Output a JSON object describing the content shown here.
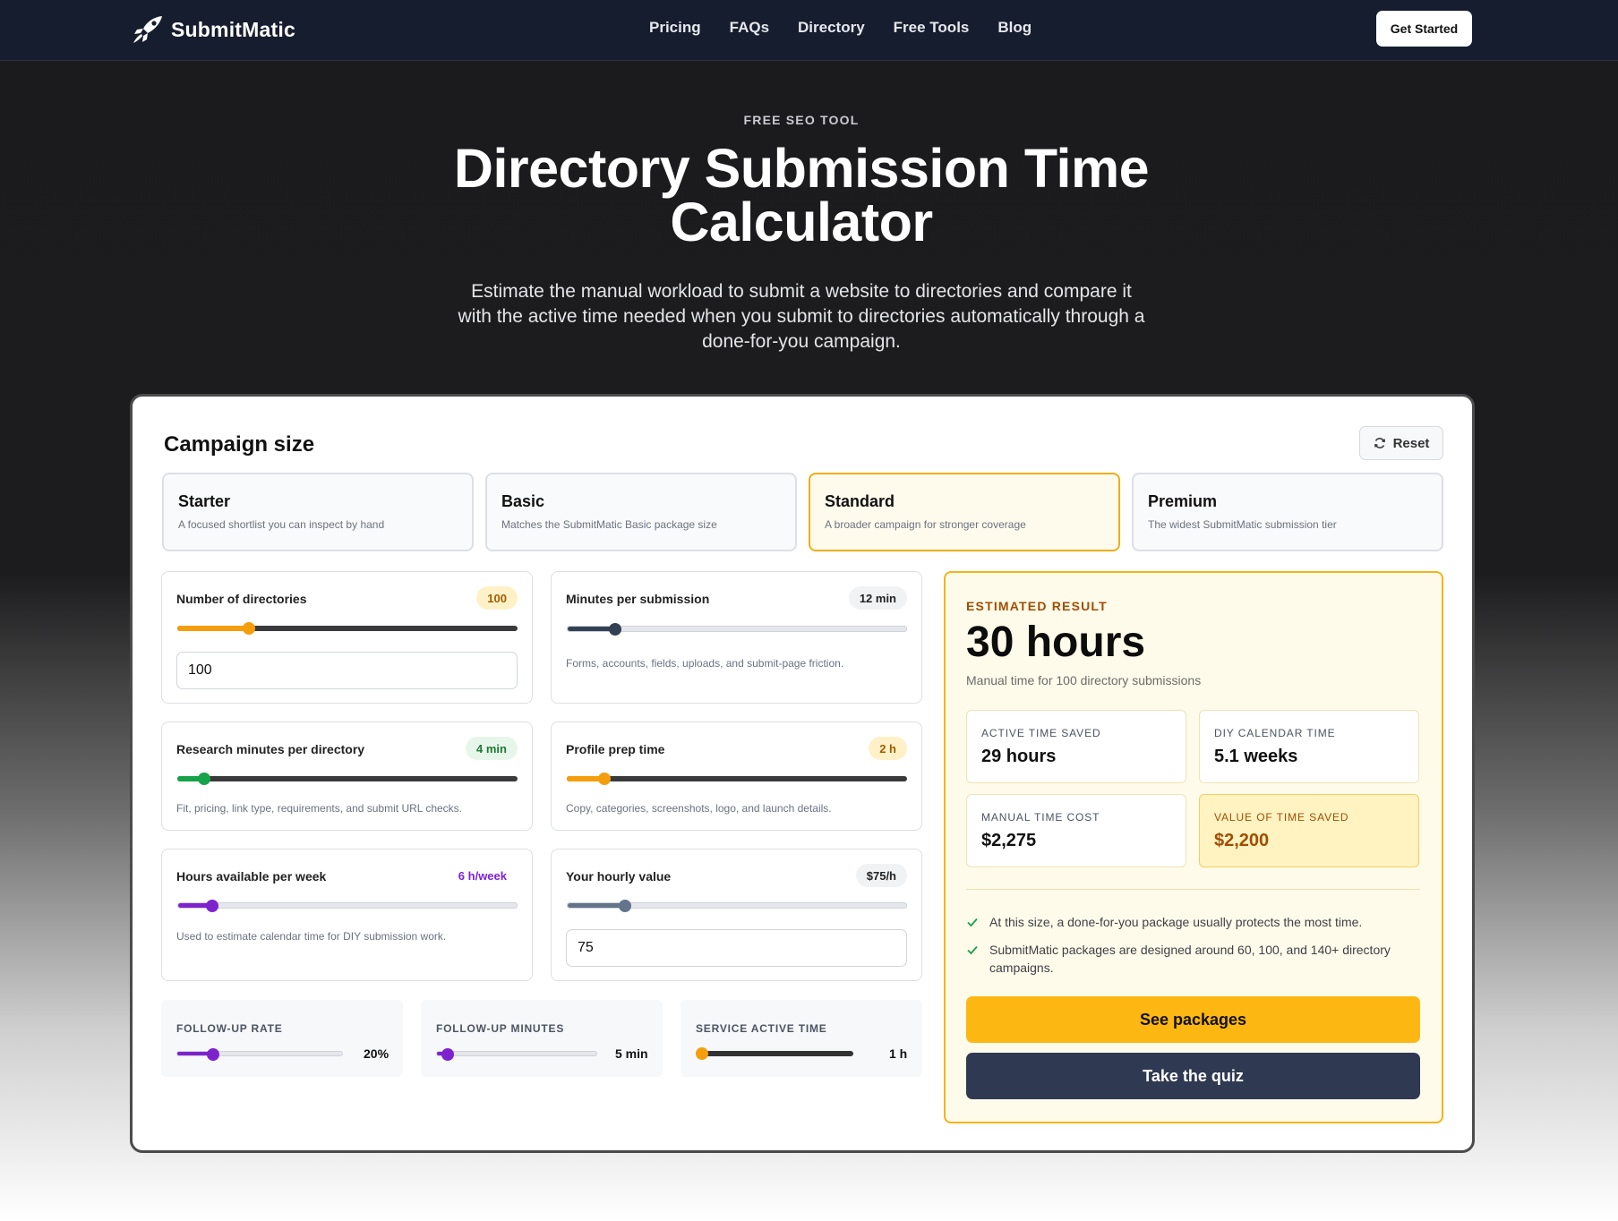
{
  "nav": {
    "brand": "SubmitMatic",
    "links": [
      "Pricing",
      "FAQs",
      "Directory",
      "Free Tools",
      "Blog"
    ],
    "cta": "Get Started"
  },
  "hero": {
    "eyebrow": "FREE SEO TOOL",
    "title": "Directory Submission Time Calculator",
    "subtitle": "Estimate the manual workload to submit a website to directories and compare it with the active time needed when you submit to directories automatically through a done-for-you campaign."
  },
  "campaign": {
    "title": "Campaign size",
    "reset": "Reset",
    "tiers": [
      {
        "name": "Starter",
        "desc": "A focused shortlist you can inspect by hand"
      },
      {
        "name": "Basic",
        "desc": "Matches the SubmitMatic Basic package size"
      },
      {
        "name": "Standard",
        "desc": "A broader campaign for stronger coverage",
        "selected": true
      },
      {
        "name": "Premium",
        "desc": "The widest SubmitMatic submission tier"
      }
    ]
  },
  "inputs": {
    "directories": {
      "label": "Number of directories",
      "value": "100",
      "input_value": "100",
      "fill_pct": 21,
      "color": "#f59e0b"
    },
    "minutes": {
      "label": "Minutes per submission",
      "value": "12 min",
      "hint": "Forms, accounts, fields, uploads, and submit-page friction.",
      "fill_pct": 14,
      "color": "#334155"
    },
    "research": {
      "label": "Research minutes per directory",
      "value": "4 min",
      "hint": "Fit, pricing, link type, requirements, and submit URL checks.",
      "fill_pct": 8,
      "color": "#16a34a"
    },
    "profile": {
      "label": "Profile prep time",
      "value": "2 h",
      "hint": "Copy, categories, screenshots, logo, and launch details.",
      "fill_pct": 11,
      "color": "#f59e0b"
    },
    "hours": {
      "label": "Hours available per week",
      "value": "6 h/week",
      "hint": "Used to estimate calendar time for DIY submission work.",
      "fill_pct": 10,
      "color": "#7e22ce"
    },
    "hourly": {
      "label": "Your hourly value",
      "value": "$75/h",
      "input_value": "75",
      "fill_pct": 17,
      "color": "#64748b"
    }
  },
  "advanced": [
    {
      "label": "FOLLOW-UP RATE",
      "value": "20%",
      "fill_pct": 22,
      "color": "#7e22ce"
    },
    {
      "label": "FOLLOW-UP MINUTES",
      "value": "5 min",
      "fill_pct": 7,
      "color": "#7e22ce"
    },
    {
      "label": "SERVICE ACTIVE TIME",
      "value": "1 h",
      "fill_pct": 4,
      "color": "#f59e0b"
    }
  ],
  "result": {
    "eyebrow": "ESTIMATED RESULT",
    "headline": "30 hours",
    "subline": "Manual time for 100 directory submissions",
    "stats": [
      {
        "label": "ACTIVE TIME SAVED",
        "value": "29 hours"
      },
      {
        "label": "DIY CALENDAR TIME",
        "value": "5.1 weeks"
      },
      {
        "label": "MANUAL TIME COST",
        "value": "$2,275"
      },
      {
        "label": "VALUE OF TIME SAVED",
        "value": "$2,200"
      }
    ],
    "bullets": [
      "At this size, a done-for-you package usually protects the most time.",
      "SubmitMatic packages are designed around 60, 100, and 140+ directory campaigns."
    ],
    "primary_cta": "See packages",
    "secondary_cta": "Take the quiz"
  },
  "colors": {
    "accent": "#fdb713",
    "nav_bg": "#161d2f",
    "dark_button": "#2f3a52"
  }
}
